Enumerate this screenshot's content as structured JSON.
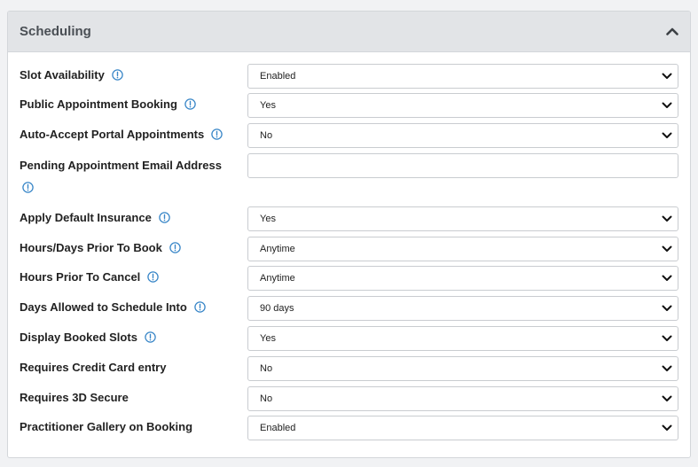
{
  "panel": {
    "title": "Scheduling",
    "collapse_icon": "chevron-up-icon"
  },
  "colors": {
    "info_icon": "#3a87c8",
    "header_bg": "#e2e4e7"
  },
  "fields": [
    {
      "label": "Slot Availability",
      "info": true,
      "type": "select",
      "value": "Enabled"
    },
    {
      "label": "Public Appointment Booking",
      "info": true,
      "type": "select",
      "value": "Yes"
    },
    {
      "label": "Auto-Accept Portal Appointments",
      "info": true,
      "type": "select",
      "value": "No"
    },
    {
      "label": "Pending Appointment Email Address",
      "info": true,
      "type": "text",
      "value": ""
    },
    {
      "label": "Apply Default Insurance",
      "info": true,
      "type": "select",
      "value": "Yes"
    },
    {
      "label": "Hours/Days Prior To Book",
      "info": true,
      "type": "select",
      "value": "Anytime"
    },
    {
      "label": "Hours Prior To Cancel",
      "info": true,
      "type": "select",
      "value": "Anytime"
    },
    {
      "label": "Days Allowed to Schedule Into",
      "info": true,
      "type": "select",
      "value": "90 days"
    },
    {
      "label": "Display Booked Slots",
      "info": true,
      "type": "select",
      "value": "Yes"
    },
    {
      "label": "Requires Credit Card entry",
      "info": false,
      "type": "select",
      "value": "No"
    },
    {
      "label": "Requires 3D Secure",
      "info": false,
      "type": "select",
      "value": "No"
    },
    {
      "label": "Practitioner Gallery on Booking",
      "info": false,
      "type": "select",
      "value": "Enabled"
    }
  ]
}
